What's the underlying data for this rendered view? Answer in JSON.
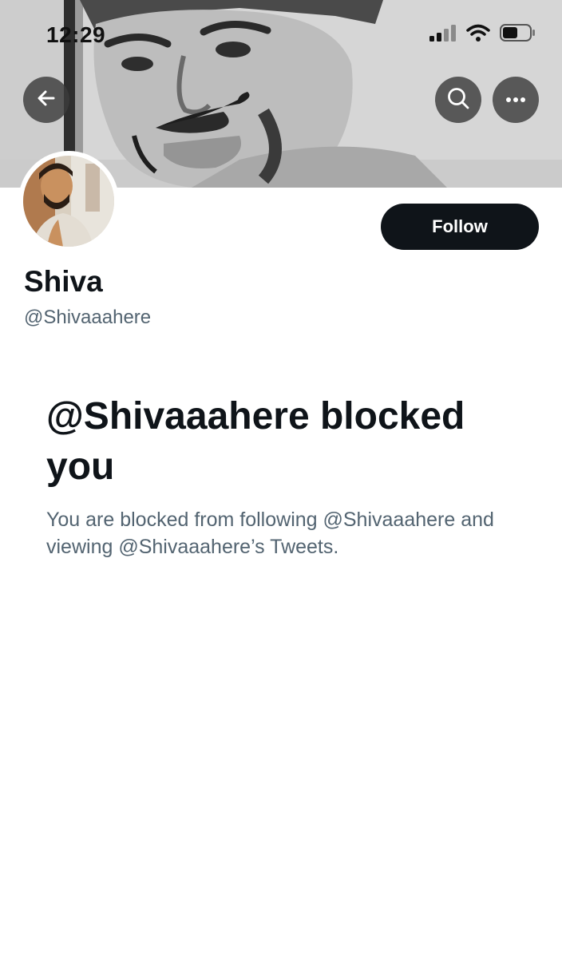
{
  "status_bar": {
    "time": "12:29",
    "icons": [
      "cellular-signal-icon",
      "wifi-icon",
      "battery-icon"
    ]
  },
  "nav": {
    "back_icon": "arrow-left-icon",
    "search_icon": "search-icon",
    "more_icon": "more-horizontal-icon"
  },
  "profile": {
    "display_name": "Shiva",
    "handle": "@Shivaaahere",
    "follow_label": "Follow"
  },
  "blocked": {
    "title": "@Shivaaahere blocked you",
    "description": "You are blocked from following @Shivaaahere and viewing @Shivaaahere’s Tweets."
  },
  "colors": {
    "primary_text": "#0f1419",
    "secondary_text": "#536471",
    "button_bg": "#0f1419",
    "button_text": "#ffffff",
    "nav_button_bg": "#3c3c3c",
    "background": "#ffffff"
  }
}
